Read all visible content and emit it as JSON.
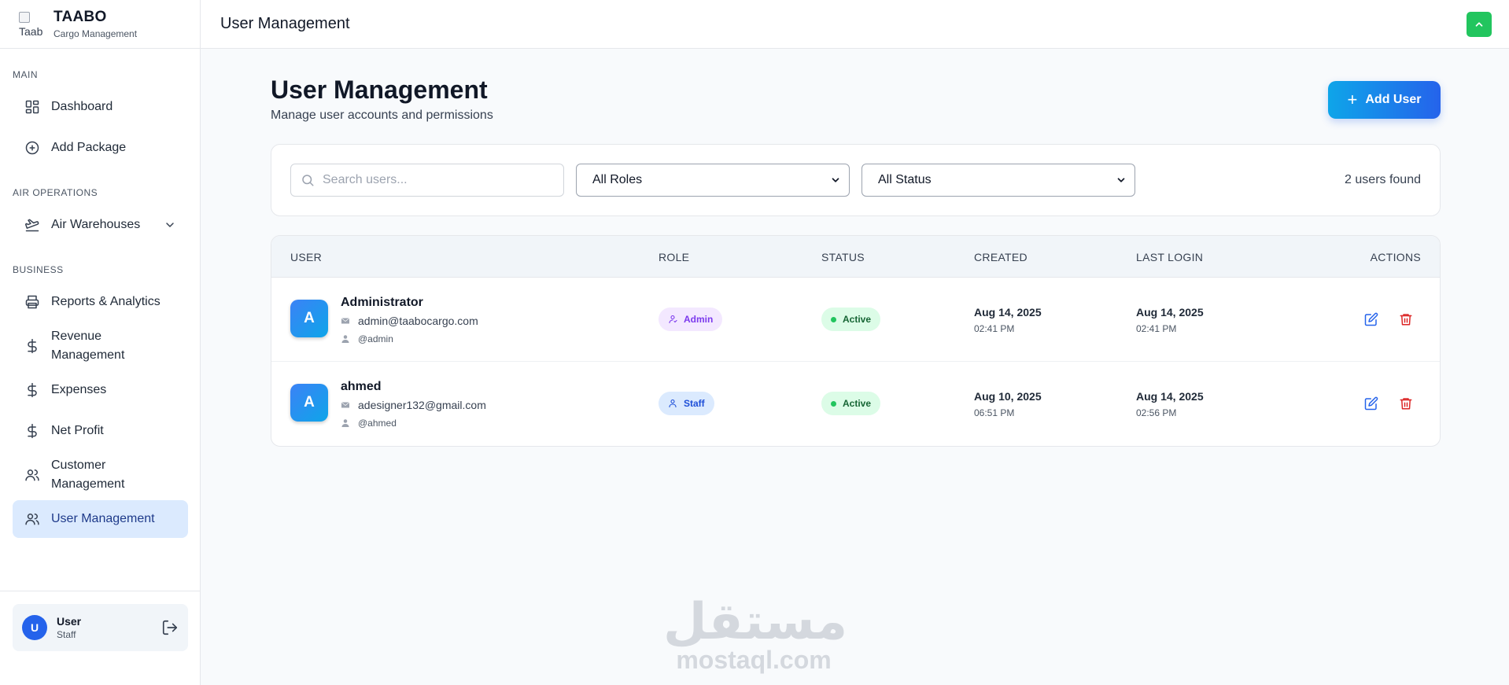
{
  "brand": {
    "title": "TAABO",
    "subtitle": "Cargo Management",
    "logo_alt": "Taab"
  },
  "sidebar": {
    "sections": {
      "main": "MAIN",
      "air": "AIR OPERATIONS",
      "business": "BUSINESS"
    },
    "items": [
      {
        "label": "Dashboard",
        "icon": "dashboard-icon"
      },
      {
        "label": "Add Package",
        "icon": "plus-circle-icon"
      },
      {
        "label": "Air Warehouses",
        "icon": "plane-icon"
      },
      {
        "label": "Reports & Analytics",
        "icon": "printer-icon"
      },
      {
        "label": "Revenue Management",
        "icon": "dollar-icon"
      },
      {
        "label": "Expenses",
        "icon": "dollar-icon"
      },
      {
        "label": "Net Profit",
        "icon": "dollar-icon"
      },
      {
        "label": "Customer Management",
        "icon": "users-icon"
      },
      {
        "label": "User Management",
        "icon": "users-icon"
      }
    ],
    "user": {
      "initial": "U",
      "name": "User",
      "role": "Staff"
    }
  },
  "topbar": {
    "title": "User Management"
  },
  "page": {
    "title": "User Management",
    "subtitle": "Manage user accounts and permissions",
    "add_button": "Add User"
  },
  "filters": {
    "search_placeholder": "Search users...",
    "role_select": "All Roles",
    "status_select": "All Status",
    "count_text": "2 users found"
  },
  "table": {
    "headers": [
      "USER",
      "ROLE",
      "STATUS",
      "CREATED",
      "LAST LOGIN",
      "ACTIONS"
    ],
    "rows": [
      {
        "initial": "A",
        "name": "Administrator",
        "email": "admin@taabocargo.com",
        "handle": "@admin",
        "role": "Admin",
        "status": "Active",
        "created_date": "Aug 14, 2025",
        "created_time": "02:41 PM",
        "login_date": "Aug 14, 2025",
        "login_time": "02:41 PM"
      },
      {
        "initial": "A",
        "name": "ahmed",
        "email": "adesigner132@gmail.com",
        "handle": "@ahmed",
        "role": "Staff",
        "status": "Active",
        "created_date": "Aug 10, 2025",
        "created_time": "06:51 PM",
        "login_date": "Aug 14, 2025",
        "login_time": "02:56 PM"
      }
    ]
  },
  "watermark": {
    "arabic": "مستقل",
    "latin": "mostaql.com"
  },
  "colors": {
    "accent": "#2563eb",
    "active_nav": "#dbeafe",
    "success": "#22c55e",
    "danger": "#dc2626"
  }
}
